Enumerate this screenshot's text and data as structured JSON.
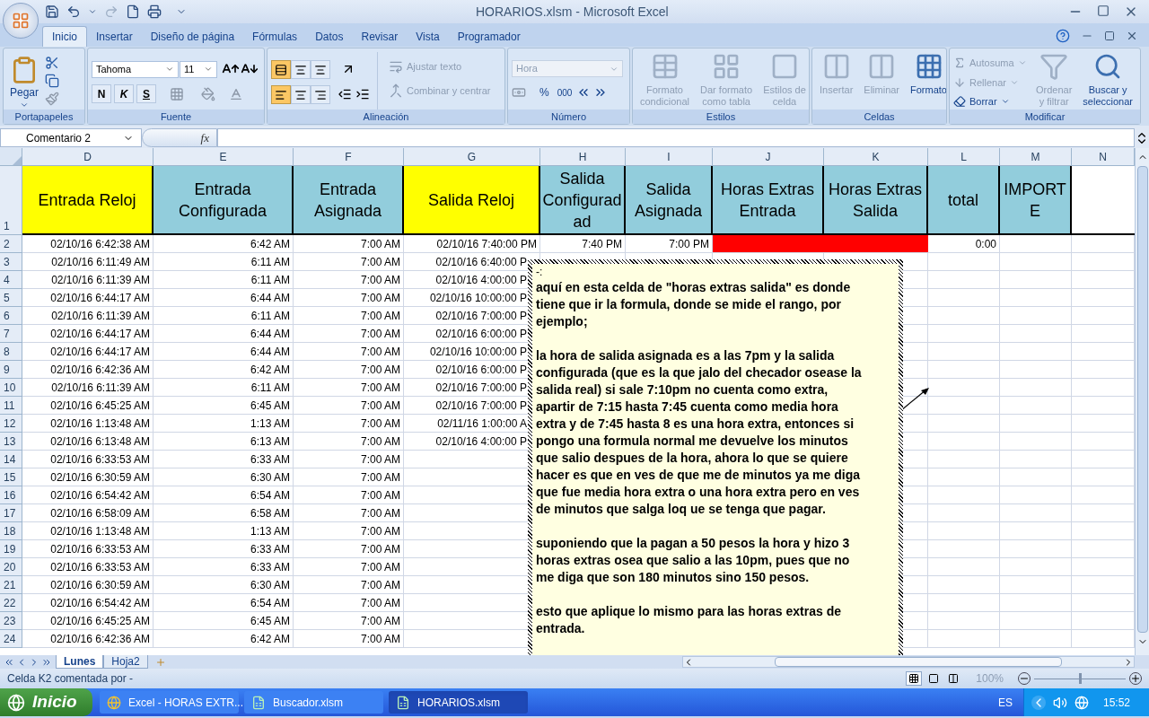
{
  "window": {
    "title": "HORARIOS.xlsm - Microsoft Excel"
  },
  "ribbon_tabs": [
    {
      "label": "Inicio",
      "selected": true
    },
    {
      "label": "Insertar",
      "selected": false
    },
    {
      "label": "Diseño de página",
      "selected": false
    },
    {
      "label": "Fórmulas",
      "selected": false
    },
    {
      "label": "Datos",
      "selected": false
    },
    {
      "label": "Revisar",
      "selected": false
    },
    {
      "label": "Vista",
      "selected": false
    },
    {
      "label": "Programador",
      "selected": false
    }
  ],
  "clipboard": {
    "title": "Portapapeles",
    "paste": "Pegar"
  },
  "font": {
    "title": "Fuente",
    "family": "Tahoma",
    "size": "11",
    "styles": [
      "N",
      "K",
      "S"
    ]
  },
  "alignment": {
    "title": "Alineación",
    "vertical": [
      {
        "selected": true
      },
      {
        "selected": false
      },
      {
        "selected": false
      }
    ],
    "horizontal": [
      {
        "selected": true
      },
      {
        "selected": false
      },
      {
        "selected": false
      }
    ],
    "wrap": {
      "label": "Ajustar texto",
      "disabled": true
    },
    "merge": {
      "label": "Combinar y centrar",
      "disabled": true
    }
  },
  "number": {
    "title": "Número",
    "format": "Hora",
    "percent": "%",
    "thousands": "000"
  },
  "styles": {
    "title": "Estilos",
    "items": [
      {
        "lines": [
          "Formato",
          "condicional"
        ],
        "disabled": true
      },
      {
        "lines": [
          "Dar formato",
          "como tabla"
        ],
        "disabled": true
      },
      {
        "lines": [
          "Estilos de",
          "celda"
        ],
        "disabled": true
      }
    ]
  },
  "cells_group": {
    "title": "Celdas",
    "items": [
      {
        "lines": [
          "Insertar"
        ],
        "disabled": true
      },
      {
        "lines": [
          "Eliminar"
        ],
        "disabled": true
      },
      {
        "lines": [
          "Formato"
        ],
        "disabled": false
      }
    ]
  },
  "editing": {
    "title": "Modificar",
    "small": [
      {
        "label": "Autosuma",
        "disabled": true
      },
      {
        "label": "Rellenar",
        "disabled": true
      },
      {
        "label": "Borrar",
        "disabled": false
      }
    ],
    "items": [
      {
        "lines": [
          "Ordenar",
          "y filtrar"
        ],
        "disabled": true
      },
      {
        "lines": [
          "Buscar y",
          "seleccionar"
        ],
        "disabled": false
      }
    ]
  },
  "formula_bar": {
    "name_box": "Comentario 2",
    "function_label": "fx"
  },
  "columns": [
    {
      "letter": "D",
      "title": "Entrada Reloj",
      "color": "#ffff00"
    },
    {
      "letter": "E",
      "title": "Entrada Configurada",
      "color": "#92cddc"
    },
    {
      "letter": "F",
      "title": "Entrada Asignada",
      "color": "#92cddc"
    },
    {
      "letter": "G",
      "title": "Salida Reloj",
      "color": "#ffff00"
    },
    {
      "letter": "H",
      "title": "Salida Configuradad",
      "color": "#92cddc"
    },
    {
      "letter": "I",
      "title": "Salida Asignada",
      "color": "#92cddc"
    },
    {
      "letter": "J",
      "title": "Horas Extras Entrada",
      "color": "#92cddc"
    },
    {
      "letter": "K",
      "title": "Horas Extras Salida",
      "color": "#92cddc"
    },
    {
      "letter": "L",
      "title": "total",
      "color": "#92cddc"
    },
    {
      "letter": "M",
      "title": "IMPORTE",
      "color": "#92cddc"
    },
    {
      "letter": "N"
    }
  ],
  "header_row": "1",
  "rows": [
    {
      "number": "2",
      "entrada_reloj": "02/10/16 6:42:38 AM",
      "entrada_configurada": "6:42 AM",
      "entrada_asignada": "7:00 AM",
      "salida_reloj": "02/10/16 7:40:00 PM",
      "salida_configurada": "7:40 PM",
      "salida_asignada": "7:00 PM",
      "horas_extras": {
        "color": "#ff0000"
      },
      "total": "0:00"
    },
    {
      "number": "3",
      "entrada_reloj": "02/10/16 6:11:49 AM",
      "entrada_configurada": "6:11 AM",
      "entrada_asignada": "7:00 AM",
      "salida_reloj": "02/10/16 6:40:00 P"
    },
    {
      "number": "4",
      "entrada_reloj": "02/10/16 6:11:39 AM",
      "entrada_configurada": "6:11 AM",
      "entrada_asignada": "7:00 AM",
      "salida_reloj": "02/10/16 4:00:00 P"
    },
    {
      "number": "5",
      "entrada_reloj": "02/10/16 6:44:17 AM",
      "entrada_configurada": "6:44 AM",
      "entrada_asignada": "7:00 AM",
      "salida_reloj": "02/10/16 10:00:00 P"
    },
    {
      "number": "6",
      "entrada_reloj": "02/10/16 6:11:39 AM",
      "entrada_configurada": "6:11 AM",
      "entrada_asignada": "7:00 AM",
      "salida_reloj": "02/10/16 7:00:00 P"
    },
    {
      "number": "7",
      "entrada_reloj": "02/10/16 6:44:17 AM",
      "entrada_configurada": "6:44 AM",
      "entrada_asignada": "7:00 AM",
      "salida_reloj": "02/10/16 6:00:00 P"
    },
    {
      "number": "8",
      "entrada_reloj": "02/10/16 6:44:17 AM",
      "entrada_configurada": "6:44 AM",
      "entrada_asignada": "7:00 AM",
      "salida_reloj": "02/10/16 10:00:00 P"
    },
    {
      "number": "9",
      "entrada_reloj": "02/10/16 6:42:36 AM",
      "entrada_configurada": "6:42 AM",
      "entrada_asignada": "7:00 AM",
      "salida_reloj": "02/10/16 6:00:00 P"
    },
    {
      "number": "10",
      "entrada_reloj": "02/10/16 6:11:39 AM",
      "entrada_configurada": "6:11 AM",
      "entrada_asignada": "7:00 AM",
      "salida_reloj": "02/10/16 7:00:00 P"
    },
    {
      "number": "11",
      "entrada_reloj": "02/10/16 6:45:25 AM",
      "entrada_configurada": "6:45 AM",
      "entrada_asignada": "7:00 AM",
      "salida_reloj": "02/10/16 7:00:00 P"
    },
    {
      "number": "12",
      "entrada_reloj": "02/10/16 1:13:48 AM",
      "entrada_configurada": "1:13 AM",
      "entrada_asignada": "7:00 AM",
      "salida_reloj": "02/11/16 1:00:00 A"
    },
    {
      "number": "13",
      "entrada_reloj": "02/10/16 6:13:48 AM",
      "entrada_configurada": "6:13 AM",
      "entrada_asignada": "7:00 AM",
      "salida_reloj": "02/10/16 4:00:00 P"
    },
    {
      "number": "14",
      "entrada_reloj": "02/10/16 6:33:53 AM",
      "entrada_configurada": "6:33 AM",
      "entrada_asignada": "7:00 AM"
    },
    {
      "number": "15",
      "entrada_reloj": "02/10/16 6:30:59 AM",
      "entrada_configurada": "6:30 AM",
      "entrada_asignada": "7:00 AM"
    },
    {
      "number": "16",
      "entrada_reloj": "02/10/16 6:54:42 AM",
      "entrada_configurada": "6:54 AM",
      "entrada_asignada": "7:00 AM"
    },
    {
      "number": "17",
      "entrada_reloj": "02/10/16 6:58:09 AM",
      "entrada_configurada": "6:58 AM",
      "entrada_asignada": "7:00 AM"
    },
    {
      "number": "18",
      "entrada_reloj": "02/10/16 1:13:48 AM",
      "entrada_configurada": "1:13 AM",
      "entrada_asignada": "7:00 AM"
    },
    {
      "number": "19",
      "entrada_reloj": "02/10/16 6:33:53 AM",
      "entrada_configurada": "6:33 AM",
      "entrada_asignada": "7:00 AM"
    },
    {
      "number": "20",
      "entrada_reloj": "02/10/16 6:33:53 AM",
      "entrada_configurada": "6:33 AM",
      "entrada_asignada": "7:00 AM"
    },
    {
      "number": "21",
      "entrada_reloj": "02/10/16 6:30:59 AM",
      "entrada_configurada": "6:30 AM",
      "entrada_asignada": "7:00 AM"
    },
    {
      "number": "22",
      "entrada_reloj": "02/10/16 6:54:42 AM",
      "entrada_configurada": "6:54 AM",
      "entrada_asignada": "7:00 AM"
    },
    {
      "number": "23",
      "entrada_reloj": "02/10/16 6:45:25 AM",
      "entrada_configurada": "6:45 AM",
      "entrada_asignada": "7:00 AM"
    },
    {
      "number": "24",
      "entrada_reloj": "02/10/16 6:42:36 AM",
      "entrada_configurada": "6:42 AM",
      "entrada_asignada": "7:00 AM"
    }
  ],
  "comment": {
    "author": "-:",
    "paragraphs": [
      [
        "aquí en esta celda de \"horas extras salida\" es donde",
        "tiene que ir la formula, donde se mide el rango, por",
        "ejemplo;"
      ],
      [
        "la hora de salida asignada es a las 7pm y la salida",
        "configurada (que es la que jalo del checador osease la",
        "salida real) si sale 7:10pm no cuenta como extra,",
        "apartir de 7:15 hasta 7:45 cuenta como media hora",
        "extra y de 7:45 hasta 8 es una hora extra, entonces si",
        "pongo una formula normal me devuelve los minutos",
        "que salio despues de la hora, ahora lo que se quiere",
        "hacer es que en ves de que me de minutos ya me diga",
        "que fue media hora extra o una hora extra pero en ves",
        "de minutos que salga loq ue se tenga que pagar."
      ],
      [
        "suponiendo que la pagan a 50 pesos la hora y hizo 3",
        "horas extras osea que salio a las 10pm, pues que no",
        "me diga que son 180 minutos sino 150 pesos."
      ],
      [
        "esto que aplique lo mismo para las horas extras de",
        "entrada."
      ]
    ]
  },
  "sheet_tabs": [
    {
      "label": "Lunes",
      "selected": true
    },
    {
      "label": "Hoja2",
      "selected": false
    }
  ],
  "status_bar": {
    "text": "Celda K2 comentada por -",
    "views": [
      {
        "selected": true
      },
      {
        "selected": false
      },
      {
        "selected": false
      }
    ],
    "zoom": {
      "label": "100%",
      "level": 0.5
    }
  },
  "taskbar": {
    "start": "Inicio",
    "tasks": [
      {
        "label": "Excel - HORAS EXTR...",
        "kind": "browser",
        "selected": false
      },
      {
        "label": "Buscador.xlsm",
        "kind": "excel",
        "selected": false
      },
      {
        "label": "HORARIOS.xlsm",
        "kind": "excel",
        "selected": true
      }
    ],
    "language": "ES",
    "clock": "15:52"
  }
}
